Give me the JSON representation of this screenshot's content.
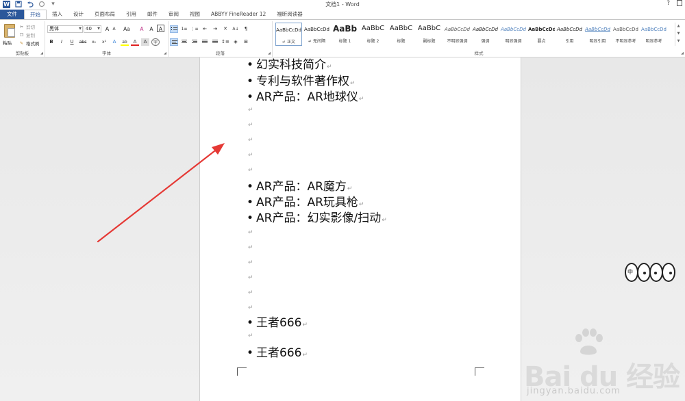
{
  "titlebar": {
    "logo": "W",
    "title": "文档1 - Word",
    "help": "?",
    "save_icon": "save-icon",
    "undo_icon": "undo-icon",
    "redo_icon": "redo-icon"
  },
  "tabs": [
    "文件",
    "开始",
    "插入",
    "设计",
    "页面布局",
    "引用",
    "邮件",
    "审阅",
    "视图",
    "ABBYY FineReader 12",
    "福昕阅读器"
  ],
  "active_tab": "开始",
  "clipboard": {
    "paste": "粘贴",
    "cut": "剪切",
    "copy": "复制",
    "format_painter": "格式刷",
    "group": "剪贴板"
  },
  "font": {
    "name": "黑体",
    "size": "40",
    "grow": "A",
    "shrink": "A",
    "case": "Aa",
    "clear": "A",
    "phonetic": "A",
    "border": "A",
    "bold": "B",
    "italic": "I",
    "underline": "U",
    "strike": "abc",
    "sub": "x₂",
    "sup": "x²",
    "effects": "A",
    "highlight": "ab",
    "color": "A",
    "shade": "A",
    "circle": "字",
    "group": "字体",
    "font_color": "#e02020",
    "highlight_color": "#ffff00"
  },
  "paragraph": {
    "group": "段落",
    "show_marks": "¶",
    "sort": "A↓",
    "asian": "A"
  },
  "styles": {
    "group": "样式",
    "items": [
      {
        "sample": "AaBbCcDd",
        "name": "↵ 正文"
      },
      {
        "sample": "AaBbCcDd",
        "name": "↵ 无间隔"
      },
      {
        "sample": "AaBb",
        "name": "标题 1"
      },
      {
        "sample": "AaBbC",
        "name": "标题 2"
      },
      {
        "sample": "AaBbC",
        "name": "标题"
      },
      {
        "sample": "AaBbC",
        "name": "副标题"
      },
      {
        "sample": "AaBbCcDd",
        "name": "不明显强调"
      },
      {
        "sample": "AaBbCcDd",
        "name": "强调"
      },
      {
        "sample": "AaBbCcDd",
        "name": "明显强调"
      },
      {
        "sample": "AaBbCcDd",
        "name": "要点"
      },
      {
        "sample": "AaBbCcDd",
        "name": "引用"
      },
      {
        "sample": "AaBbCcDd",
        "name": "明显引用"
      },
      {
        "sample": "AaBbCcDd",
        "name": "不明显参考"
      },
      {
        "sample": "AaBbCcDd",
        "name": "明显参考"
      }
    ]
  },
  "document": {
    "lines": [
      {
        "bullet": "•",
        "text": "幻实科技简介"
      },
      {
        "bullet": "•",
        "text": "专利与软件著作权"
      },
      {
        "bullet": "•",
        "text": "AR产品：AR地球仪"
      },
      {
        "bullet": "•",
        "text": "AR产品：AR魔方"
      },
      {
        "bullet": "•",
        "text": "AR产品：AR玩具枪"
      },
      {
        "bullet": "•",
        "text": "AR产品：幻实影像/扫动"
      },
      {
        "bullet": "•",
        "text": "王者666"
      },
      {
        "bullet": "•",
        "text": "王者666"
      }
    ],
    "paragraph_mark": "↵"
  },
  "face_char": "中",
  "watermark": {
    "text": "Bai du 经验",
    "url": "jingyan.baidu.com"
  },
  "colors": {
    "accent": "#2b579a",
    "arrow": "#e53935"
  }
}
